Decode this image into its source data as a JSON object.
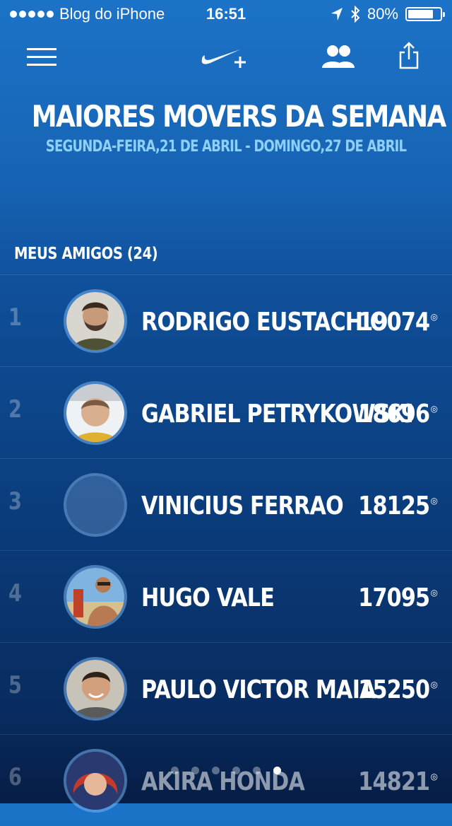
{
  "status_bar": {
    "carrier": "Blog do iPhone",
    "time": "16:51",
    "battery": "80%",
    "battery_level": 0.8,
    "icons": [
      "location-icon",
      "bluetooth-icon",
      "battery-icon"
    ]
  },
  "nav": {
    "icons": [
      "menu-icon",
      "nike-plus-logo",
      "friends-icon",
      "share-icon"
    ]
  },
  "header": {
    "title": "MAIORES MOVERS DA SEMANA",
    "subtitle": "SEGUNDA-FEIRA,21 DE ABRIL - DOMINGO,27 DE ABRIL"
  },
  "section": {
    "label": "MEUS AMIGOS (24)"
  },
  "friends": [
    {
      "rank": "1",
      "name": "RODRIGO EUSTACHIO",
      "score": "19074",
      "avatar": "photo-beard"
    },
    {
      "rank": "2",
      "name": "GABRIEL PETRYKOWSKI",
      "score": "18696",
      "avatar": "photo-light"
    },
    {
      "rank": "3",
      "name": "VINICIUS FERRAO",
      "score": "18125",
      "avatar": "placeholder"
    },
    {
      "rank": "4",
      "name": "HUGO VALE",
      "score": "17095",
      "avatar": "photo-beach"
    },
    {
      "rank": "5",
      "name": "PAULO VICTOR MAIA",
      "score": "15250",
      "avatar": "photo-smile"
    },
    {
      "rank": "6",
      "name": "AKIRA HONDA",
      "score": "14821",
      "avatar": "photo-red"
    }
  ],
  "colors": {
    "bg_top": "#1b73c7",
    "bg_bottom": "#061d45",
    "subtitle": "#8ed0f6"
  },
  "pager": {
    "count": 6,
    "active_index": 5
  }
}
